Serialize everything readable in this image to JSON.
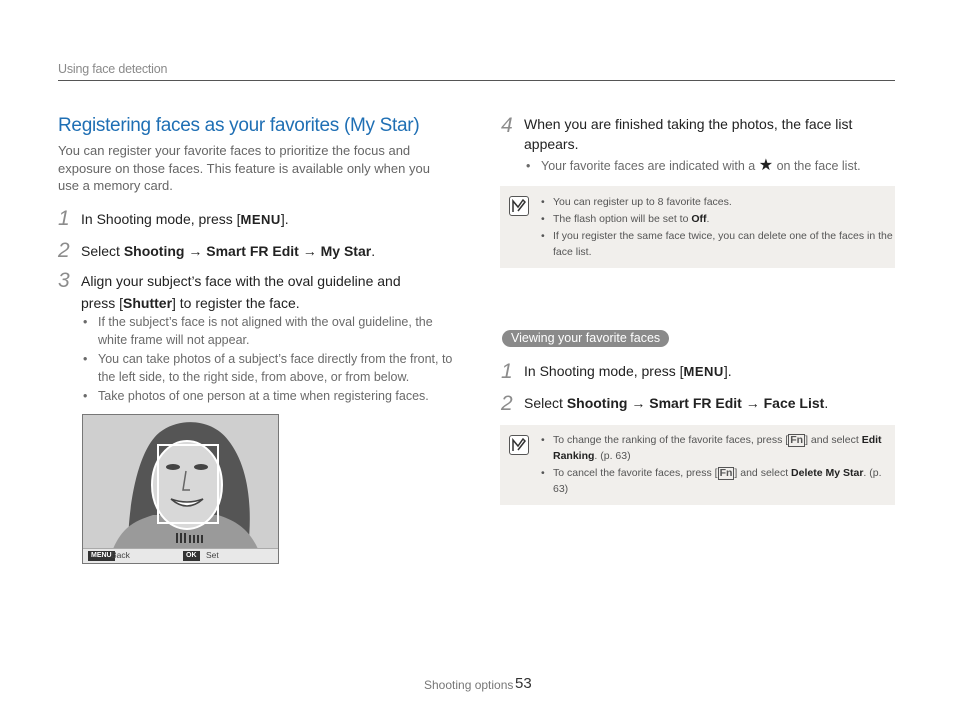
{
  "header": {
    "section": "Using face detection"
  },
  "left": {
    "title": "Registering faces as your favorites (My Star)",
    "intro": "You can register your favorite faces to prioritize the focus and exposure on those faces. This feature is available only when you use a memory card.",
    "steps": [
      {
        "num": "1",
        "pre": "In Shooting mode, press [",
        "key": "MENU",
        "post": "]."
      },
      {
        "num": "2",
        "pre": "Select ",
        "k1": "Shooting",
        "arrow": "→",
        "k2": "Smart FR Edit",
        "k3": "My Star",
        "post": "."
      },
      {
        "num": "3",
        "line1": "Align your subject’s face with the oval guideline and",
        "line2pre": "press [",
        "key": "Shutter",
        "line2post": "] to register the face."
      }
    ],
    "bullets": [
      "If the subject’s face is not aligned with the oval guideline, the white frame will not appear.",
      "You can take photos of a subject’s face directly from the front, to the left side, to the right side, from above, or from below.",
      "Take photos of one person at a time when registering faces."
    ],
    "screen": {
      "menu_tag": "MENU",
      "back": "Back",
      "ok_tag": "OK",
      "set": "Set"
    }
  },
  "right": {
    "step4": {
      "num": "4",
      "text": "When you are finished taking the photos, the face list appears.",
      "bullet_pre": "Your favorite faces are indicated with a",
      "bullet_post": "on the face list."
    },
    "note1": {
      "items": [
        {
          "text": "You can register up to 8 favorite faces."
        },
        {
          "pre": "The flash option will be set to ",
          "bold": "Off",
          "post": "."
        },
        {
          "text": "If you register the same face twice, you can delete one of the faces in the face list."
        }
      ]
    },
    "section_label": "Viewing your favorite faces",
    "steps": [
      {
        "num": "1",
        "pre": "In Shooting mode, press [",
        "key": "MENU",
        "post": "]."
      },
      {
        "num": "2",
        "pre": "Select ",
        "k1": "Shooting",
        "arrow": "→",
        "k2": "Smart FR Edit",
        "k3": "Face List",
        "post": "."
      }
    ],
    "note2": {
      "items": [
        {
          "pre": "To change the ranking of the favorite faces, press [",
          "key": "Fn",
          "mid": "] and select ",
          "bold": "Edit Ranking",
          "post": ". (p. 63)"
        },
        {
          "pre": "To cancel the favorite faces, press [",
          "key": "Fn",
          "mid": "] and select ",
          "bold": "Delete My Star",
          "post": ". (p. 63)"
        }
      ]
    }
  },
  "footer": {
    "label": "Shooting options",
    "page": "53"
  },
  "colors": {
    "title_blue": "#1f6fb4",
    "note_bg": "#f1efec",
    "pill_bg": "#8a8a8a"
  }
}
